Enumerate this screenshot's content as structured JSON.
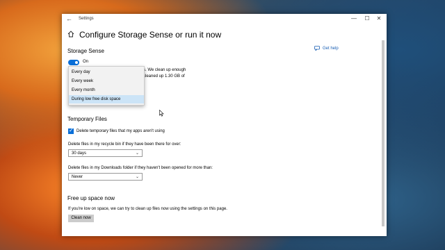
{
  "window": {
    "title": "Settings",
    "back_glyph": "←",
    "min_glyph": "—",
    "max_glyph": "☐",
    "close_glyph": "✕"
  },
  "page": {
    "title": "Configure Storage Sense or run it now"
  },
  "help": {
    "label": "Get help"
  },
  "storage_sense": {
    "heading": "Storage Sense",
    "toggle_label": "On",
    "toggle_state": "on",
    "partial_text_1": "s. We clean up enough",
    "partial_text_2": "cleaned up 1.30 GB of"
  },
  "run_dropdown": {
    "options": [
      "Every day",
      "Every week",
      "Every month",
      "During low free disk space"
    ],
    "selected_index": 3
  },
  "temporary_files": {
    "heading": "Temporary Files",
    "checkbox_label": "Delete temporary files that my apps aren't using",
    "checkbox_checked": true,
    "recycle_label": "Delete files in my recycle bin if they have been there for over:",
    "recycle_value": "30 days",
    "downloads_label": "Delete files in my Downloads folder if they haven't been opened for more than:",
    "downloads_value": "Never",
    "chevron_glyph": "⌄"
  },
  "free_up": {
    "heading": "Free up space now",
    "description": "If you're low on space, we can try to clean up files now using the settings on this page.",
    "button_label": "Clean now"
  },
  "colors": {
    "accent": "#0a6fd8",
    "selected_item": "#cce4f7",
    "link": "#1a5fb4"
  }
}
